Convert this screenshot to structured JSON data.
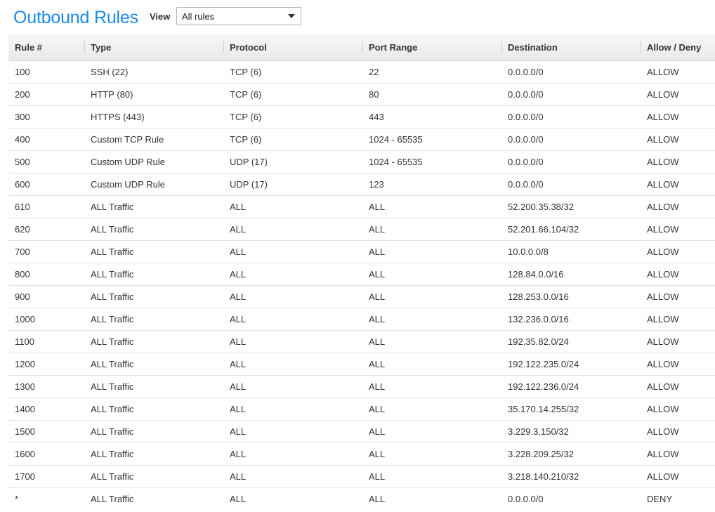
{
  "header": {
    "title": "Outbound Rules",
    "view_label": "View",
    "view_select_value": "All rules"
  },
  "table": {
    "columns": [
      "Rule #",
      "Type",
      "Protocol",
      "Port Range",
      "Destination",
      "Allow / Deny"
    ],
    "rows": [
      [
        "100",
        "SSH (22)",
        "TCP (6)",
        "22",
        "0.0.0.0/0",
        "ALLOW"
      ],
      [
        "200",
        "HTTP (80)",
        "TCP (6)",
        "80",
        "0.0.0.0/0",
        "ALLOW"
      ],
      [
        "300",
        "HTTPS (443)",
        "TCP (6)",
        "443",
        "0.0.0.0/0",
        "ALLOW"
      ],
      [
        "400",
        "Custom TCP Rule",
        "TCP (6)",
        "1024 - 65535",
        "0.0.0.0/0",
        "ALLOW"
      ],
      [
        "500",
        "Custom UDP Rule",
        "UDP (17)",
        "1024 - 65535",
        "0.0.0.0/0",
        "ALLOW"
      ],
      [
        "600",
        "Custom UDP Rule",
        "UDP (17)",
        "123",
        "0.0.0.0/0",
        "ALLOW"
      ],
      [
        "610",
        "ALL Traffic",
        "ALL",
        "ALL",
        "52.200.35.38/32",
        "ALLOW"
      ],
      [
        "620",
        "ALL Traffic",
        "ALL",
        "ALL",
        "52.201.66.104/32",
        "ALLOW"
      ],
      [
        "700",
        "ALL Traffic",
        "ALL",
        "ALL",
        "10.0.0.0/8",
        "ALLOW"
      ],
      [
        "800",
        "ALL Traffic",
        "ALL",
        "ALL",
        "128.84.0.0/16",
        "ALLOW"
      ],
      [
        "900",
        "ALL Traffic",
        "ALL",
        "ALL",
        "128.253.0.0/16",
        "ALLOW"
      ],
      [
        "1000",
        "ALL Traffic",
        "ALL",
        "ALL",
        "132.236.0.0/16",
        "ALLOW"
      ],
      [
        "1100",
        "ALL Traffic",
        "ALL",
        "ALL",
        "192.35.82.0/24",
        "ALLOW"
      ],
      [
        "1200",
        "ALL Traffic",
        "ALL",
        "ALL",
        "192.122.235.0/24",
        "ALLOW"
      ],
      [
        "1300",
        "ALL Traffic",
        "ALL",
        "ALL",
        "192.122.236.0/24",
        "ALLOW"
      ],
      [
        "1400",
        "ALL Traffic",
        "ALL",
        "ALL",
        "35.170.14.255/32",
        "ALLOW"
      ],
      [
        "1500",
        "ALL Traffic",
        "ALL",
        "ALL",
        "3.229.3.150/32",
        "ALLOW"
      ],
      [
        "1600",
        "ALL Traffic",
        "ALL",
        "ALL",
        "3.228.209.25/32",
        "ALLOW"
      ],
      [
        "1700",
        "ALL Traffic",
        "ALL",
        "ALL",
        "3.218.140.210/32",
        "ALLOW"
      ],
      [
        "*",
        "ALL Traffic",
        "ALL",
        "ALL",
        "0.0.0.0/0",
        "DENY"
      ]
    ]
  },
  "colors": {
    "title": "#1a8ae6",
    "allow": "#1d8102",
    "deny": "#d13212"
  }
}
